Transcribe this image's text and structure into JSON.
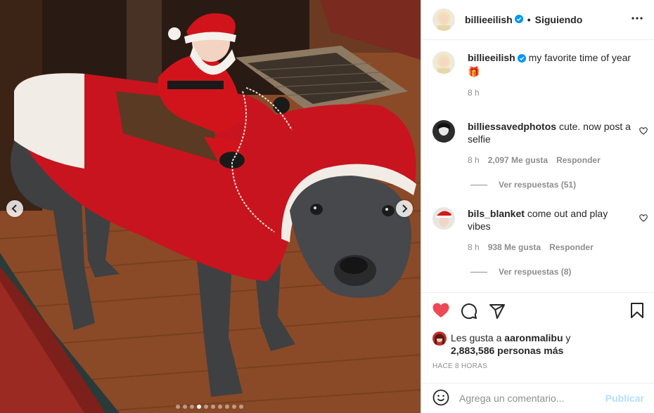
{
  "post": {
    "username": "billieeilish",
    "follow_status": "Siguiendo",
    "separator": "•",
    "caption_text": "my favorite time of year",
    "caption_emoji": "🎁",
    "caption_time": "8 h",
    "image_alt": "Dog wearing a Santa Claus riding costume",
    "carousel_total": 10,
    "carousel_active": 4
  },
  "comments": [
    {
      "username": "billiessavedphotos",
      "text": "cute. now post a selfie",
      "time": "8 h",
      "likes": "2,097 Me gusta",
      "reply_label": "Responder",
      "view_replies": "Ver respuestas (51)"
    },
    {
      "username": "bils_blanket",
      "text": "come out and play vibes",
      "time": "8 h",
      "likes": "938 Me gusta",
      "reply_label": "Responder",
      "view_replies": "Ver respuestas (8)"
    }
  ],
  "likes_summary": {
    "prefix": "Les gusta a",
    "user": "aaronmalibu",
    "conj": "y",
    "others": "2,883,586 personas más"
  },
  "timestamp": "HACE 8 HORAS",
  "comment_input": {
    "placeholder": "Agrega un comentario...",
    "publish_label": "Publicar"
  },
  "colors": {
    "like_red": "#ed4956",
    "verified_blue": "#0095f6",
    "publish_disabled": "#b2dffc",
    "muted_text": "#8e8e8e"
  },
  "icons": [
    "more-icon",
    "verified-icon",
    "heart-icon",
    "comment-icon",
    "share-icon",
    "bookmark-icon",
    "emoji-icon",
    "chevron-left-icon",
    "chevron-right-icon"
  ]
}
